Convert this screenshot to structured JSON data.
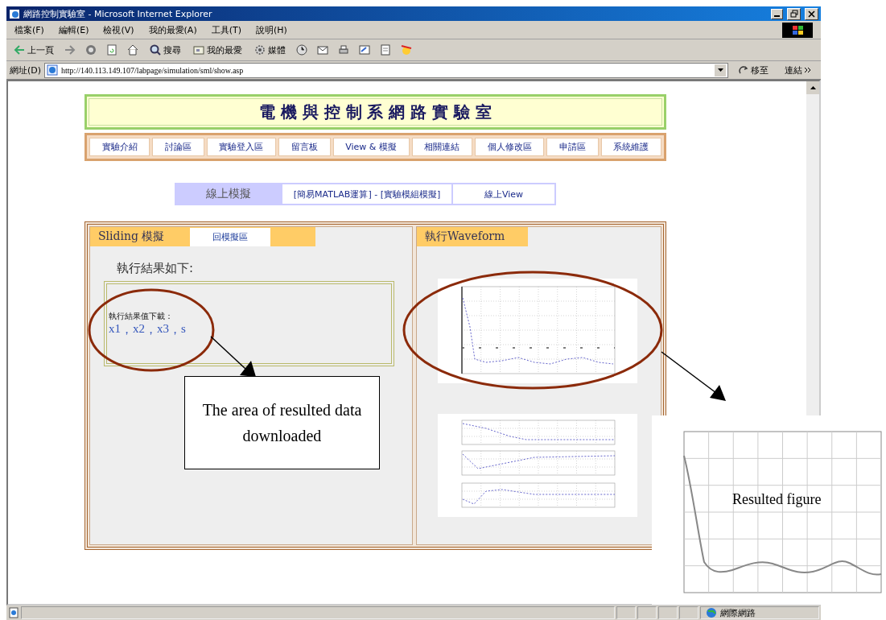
{
  "window": {
    "title": "網路控制實驗室 - Microsoft Internet Explorer"
  },
  "menu": [
    "檔案(F)",
    "編輯(E)",
    "檢視(V)",
    "我的最愛(A)",
    "工具(T)",
    "說明(H)"
  ],
  "toolbar": [
    {
      "kind": "back",
      "label": "上一頁"
    },
    {
      "kind": "search",
      "label": "搜尋"
    },
    {
      "kind": "favorites",
      "label": "我的最愛"
    },
    {
      "kind": "media",
      "label": "媒體"
    }
  ],
  "address_bar": {
    "label": "網址(D)",
    "value": "http://140.113.149.107/labpage/simulation/sml/show.asp",
    "go": "移至",
    "links": "連結"
  },
  "page": {
    "heading": "電 機 與 控 制 系 網 路 實 驗 室",
    "nav": [
      "實驗介紹",
      "討論區",
      "實驗登入區",
      "留言板",
      "View & 模擬",
      "相關連結",
      "個人修改區",
      "申請區",
      "系統維護"
    ],
    "subnav": [
      {
        "label": "線上模擬",
        "selected": true
      },
      {
        "label": "[簡易MATLAB運算] - [實驗模組模擬]",
        "selected": false
      },
      {
        "label": "線上View",
        "selected": false
      }
    ],
    "left_panel": {
      "title": "Sliding 模擬",
      "back_link": "回模擬區",
      "result_heading": "執行結果如下:",
      "download_label": "執行結果值下載：",
      "downloads": [
        "x1",
        "x2",
        "x3",
        "s"
      ],
      "separator": "，"
    },
    "right_panel": {
      "title": "執行Waveform",
      "plots": [
        {
          "kind": "single"
        },
        {
          "kind": "triple"
        }
      ]
    }
  },
  "status_bar": {
    "zone": "網際網路"
  },
  "annotations": {
    "callout": "The area of resulted data downloaded",
    "figure_caption": "Resulted figure"
  }
}
